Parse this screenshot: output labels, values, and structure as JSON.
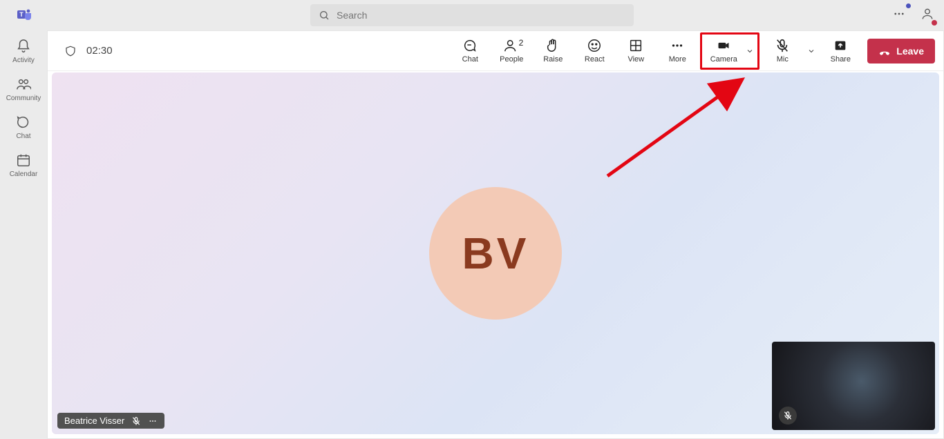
{
  "search": {
    "placeholder": "Search"
  },
  "rail": [
    {
      "label": "Activity"
    },
    {
      "label": "Community"
    },
    {
      "label": "Chat"
    },
    {
      "label": "Calendar"
    }
  ],
  "meeting": {
    "timer": "02:30",
    "toolbar": {
      "chat": "Chat",
      "people": "People",
      "people_count": "2",
      "raise": "Raise",
      "react": "React",
      "view": "View",
      "more": "More",
      "camera": "Camera",
      "mic": "Mic",
      "share": "Share"
    },
    "leave_label": "Leave",
    "participant": {
      "initials": "BV",
      "name": "Beatrice Visser"
    }
  },
  "colors": {
    "danger": "#c4314b",
    "annotation": "#e30613"
  }
}
